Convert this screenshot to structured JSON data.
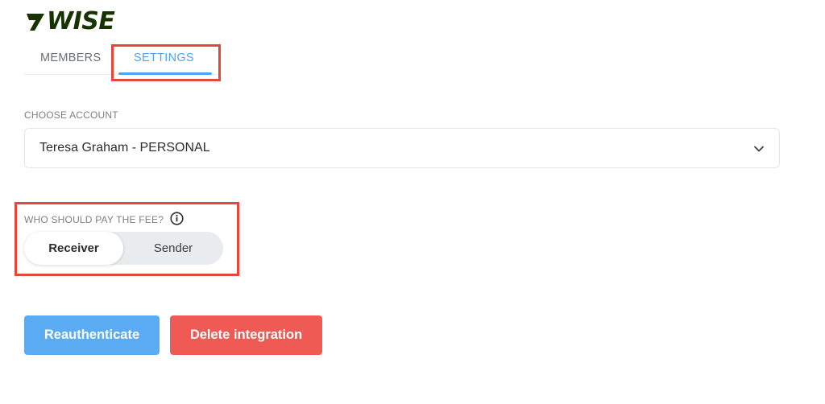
{
  "brand": {
    "logo_text": "WISE",
    "color": "#163300"
  },
  "tabs": [
    {
      "label": "MEMBERS",
      "active": false
    },
    {
      "label": "SETTINGS",
      "active": true
    }
  ],
  "account": {
    "label": "CHOOSE ACCOUNT",
    "selected": "Teresa Graham - PERSONAL",
    "icon": "chevron-down-icon"
  },
  "fee": {
    "label": "WHO SHOULD PAY THE FEE?",
    "icon": "info-icon",
    "options": [
      {
        "label": "Receiver",
        "selected": true
      },
      {
        "label": "Sender",
        "selected": false
      }
    ]
  },
  "actions": {
    "reauthenticate": "Reauthenticate",
    "delete": "Delete integration"
  },
  "colors": {
    "accent": "#4fa3ee",
    "primary_button": "#5aabf2",
    "danger_button": "#ef5a55",
    "highlight": "#e2493b"
  }
}
